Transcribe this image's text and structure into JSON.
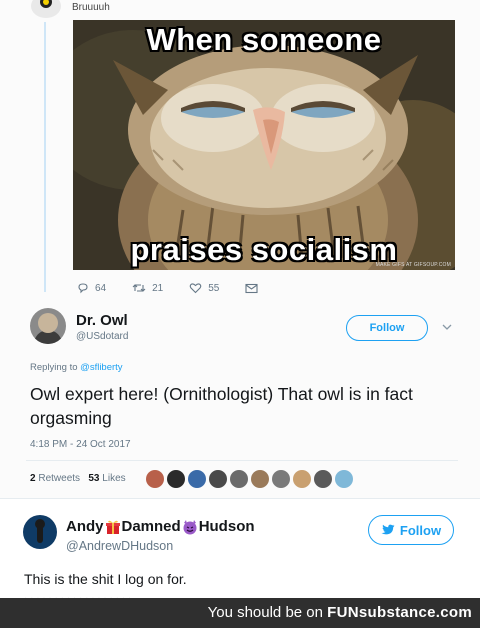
{
  "top_tweet": {
    "author_name": "Bruuuuh",
    "meme": {
      "caption_top": "When someone",
      "caption_bottom": "praises socialism",
      "watermark": "MAKE GIFS AT GIFSOUP.COM"
    },
    "actions": [
      {
        "icon": "reply-icon",
        "count": "64"
      },
      {
        "icon": "retweet-icon",
        "count": "21"
      },
      {
        "icon": "like-icon",
        "count": "55"
      },
      {
        "icon": "message-icon",
        "count": ""
      }
    ]
  },
  "reply_tweet": {
    "author_name": "Dr. Owl",
    "author_handle": "@USdotard",
    "follow_label": "Follow",
    "replying_prefix": "Replying to",
    "replying_mention": "@sfliberty",
    "text": "Owl expert here!  (Ornithologist) That owl is in fact orgasming",
    "timestamp": "4:18 PM - 24 Oct 2017",
    "retweets": "2",
    "retweets_label": "Retweets",
    "likes": "53",
    "likes_label": "Likes",
    "liker_colors": [
      "#b8604a",
      "#2a2a2a",
      "#3a6aa8",
      "#4a4a4a",
      "#6b6b6b",
      "#9a7a5a",
      "#7a7a7a",
      "#c9a070",
      "#5a5a5a",
      "#7fb8d8"
    ]
  },
  "quote_tweet": {
    "author_first": "Andy",
    "author_mid": "Damned",
    "author_last": "Hudson",
    "author_handle": "@AndrewDHudson",
    "follow_label": "Follow",
    "text": "This is the shit I log on for."
  },
  "footer": {
    "prefix": "You should be on",
    "brand": "FUNsubstance.com"
  },
  "colors": {
    "accent": "#1da1f2",
    "footer_bg": "#2f2f2f"
  }
}
